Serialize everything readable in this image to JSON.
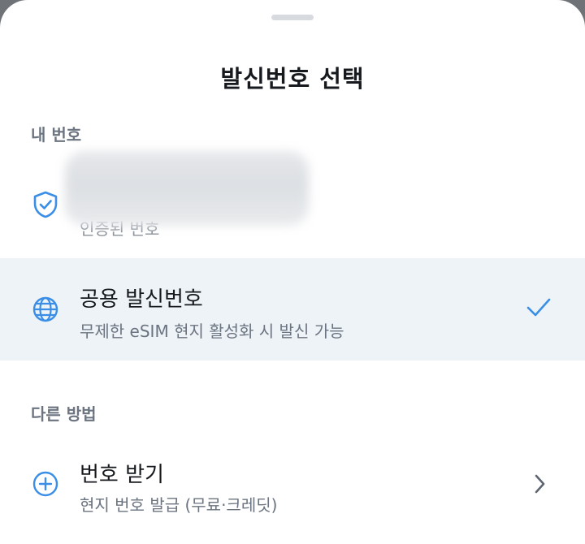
{
  "sheet": {
    "title": "발신번호 선택"
  },
  "sections": {
    "my_numbers": "내 번호",
    "other_methods": "다른 방법"
  },
  "my_number_item": {
    "icon": "shield-check-icon",
    "sub": "인증된 번호"
  },
  "public_number_item": {
    "icon": "globe-icon",
    "label": "공용 발신번호",
    "sub": "무제한 eSIM 현지 활성화 시 발신 가능",
    "selected": true,
    "selected_icon": "checkmark-icon"
  },
  "get_number_item": {
    "icon": "plus-circle-icon",
    "label": "번호 받기",
    "sub": "현지 번호 발급 (무료·크레딧)",
    "trailing_icon": "chevron-right-icon"
  },
  "colors": {
    "accent": "#3a8ee6",
    "selected_bg": "#eef3f8",
    "text_primary": "#16191d",
    "text_secondary": "#6b7480"
  }
}
